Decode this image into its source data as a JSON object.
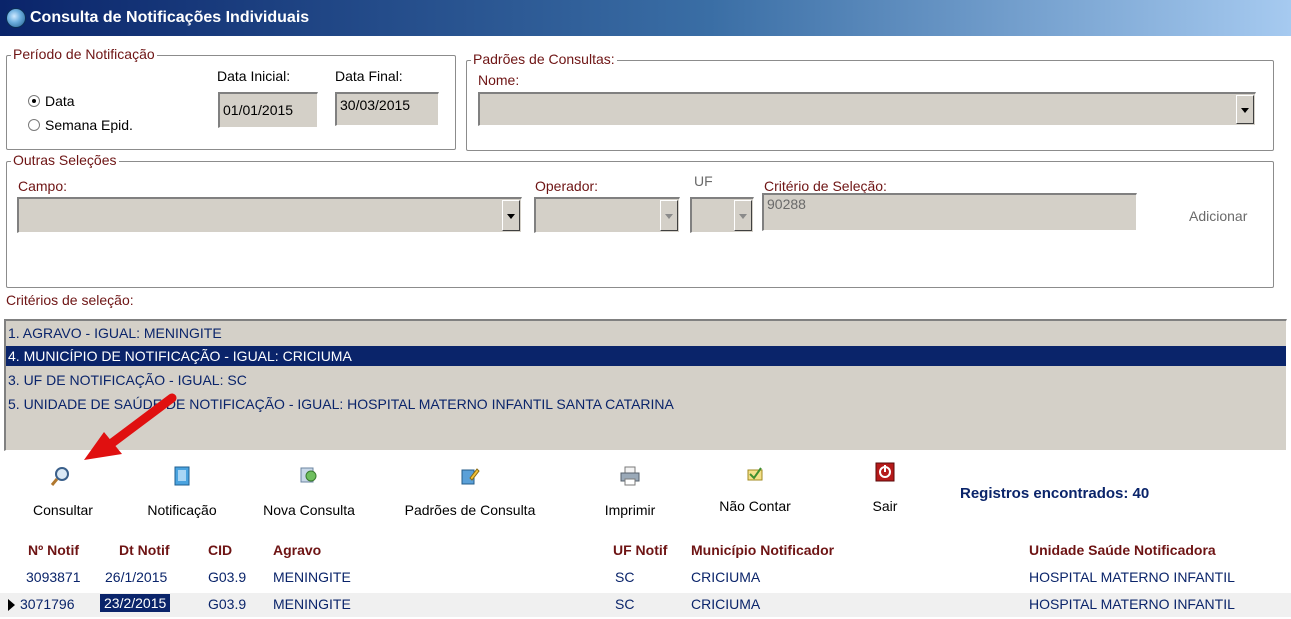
{
  "window": {
    "title": "Consulta de Notificações Individuais"
  },
  "periodo": {
    "legend": "Período de Notificação",
    "radio_data": "Data",
    "radio_semana": "Semana Epid.",
    "selected": "Data",
    "data_inicial_label": "Data Inicial:",
    "data_inicial_value": "01/01/2015",
    "data_final_label": "Data Final:",
    "data_final_value": "30/03/2015"
  },
  "padroes": {
    "legend": "Padrões de Consultas:",
    "nome_label": "Nome:",
    "nome_value": ""
  },
  "outras": {
    "legend": "Outras Seleções",
    "campo_label": "Campo:",
    "operador_label": "Operador:",
    "uf_label": "UF",
    "criterio_label": "Critério de Seleção:",
    "criterio_value": "90288",
    "adicionar_label": "Adicionar"
  },
  "criterios": {
    "label": "Critérios de seleção:",
    "items": [
      "1. AGRAVO  -  IGUAL: MENINGITE",
      "4. MUNICÍPIO DE NOTIFICAÇÃO  -  IGUAL: CRICIUMA",
      "3. UF DE NOTIFICAÇÃO  -  IGUAL: SC",
      "5. UNIDADE DE SAÚDE DE NOTIFICAÇÃO  -  IGUAL: HOSPITAL MATERNO INFANTIL SANTA CATARINA"
    ],
    "selected_index": 1
  },
  "toolbar": {
    "consultar": "Consultar",
    "notificacao": "Notificação",
    "nova_consulta": "Nova Consulta",
    "padroes_consulta": "Padrões de Consulta",
    "imprimir": "Imprimir",
    "nao_contar": "Não Contar",
    "sair": "Sair",
    "registros": "Registros encontrados: 40"
  },
  "table": {
    "headers": [
      "Nº Notif",
      "Dt Notif",
      "CID",
      "Agravo",
      "UF Notif",
      "Município Notificador",
      "Unidade Saúde Notificadora"
    ],
    "rows": [
      [
        "3093871",
        "26/1/2015",
        "G03.9",
        "MENINGITE",
        "SC",
        "CRICIUMA",
        "HOSPITAL MATERNO INFANTIL"
      ],
      [
        "3071796",
        "23/2/2015",
        "G03.9",
        "MENINGITE",
        "SC",
        "CRICIUMA",
        "HOSPITAL MATERNO INFANTIL"
      ]
    ],
    "current_row_index": 1
  },
  "colors": {
    "accent_dark_red": "#6e1414",
    "selection_blue": "#0a246a",
    "arrow_red": "#e01010"
  }
}
